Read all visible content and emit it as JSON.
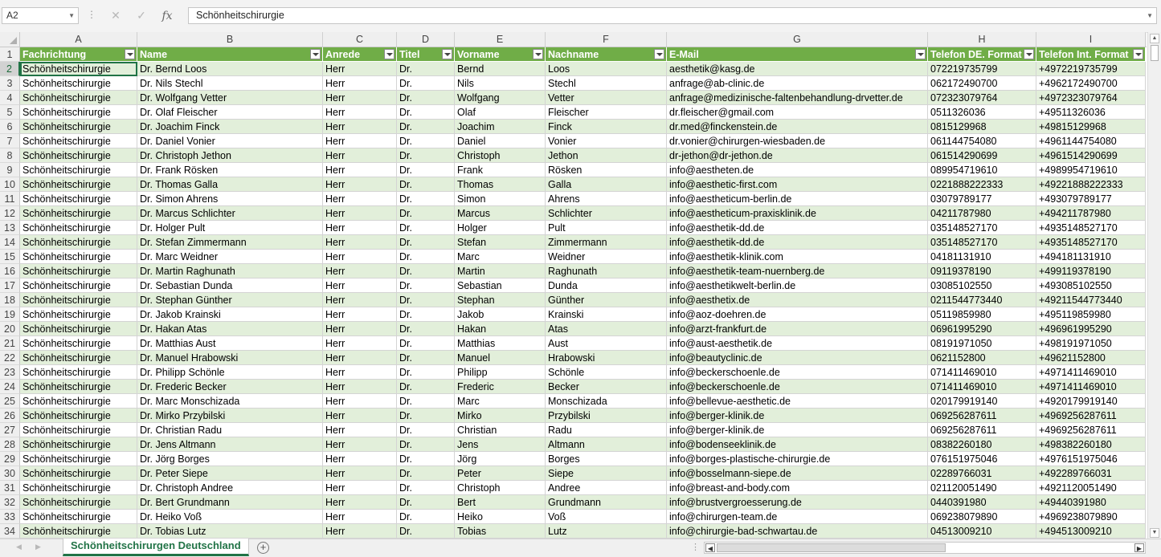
{
  "formula_bar": {
    "name_box": "A2",
    "fx_label": "fx",
    "formula": "Schönheitschirurgie"
  },
  "columns": [
    "A",
    "B",
    "C",
    "D",
    "E",
    "F",
    "G",
    "H",
    "I"
  ],
  "headers": [
    "Fachrichtung",
    "Name",
    "Anrede",
    "Titel",
    "Vorname",
    "Nachname",
    "E-Mail",
    "Telefon DE. Format",
    "Telefon Int. Format"
  ],
  "rows": [
    [
      "Schönheitschirurgie",
      "Dr. Bernd Loos",
      "Herr",
      "Dr.",
      "Bernd",
      "Loos",
      "aesthetik@kasg.de",
      "072219735799",
      "+4972219735799"
    ],
    [
      "Schönheitschirurgie",
      "Dr. Nils Stechl",
      "Herr",
      "Dr.",
      "Nils",
      "Stechl",
      "anfrage@ab-clinic.de",
      "062172490700",
      "+4962172490700"
    ],
    [
      "Schönheitschirurgie",
      "Dr. Wolfgang Vetter",
      "Herr",
      "Dr.",
      "Wolfgang",
      "Vetter",
      "anfrage@medizinische-faltenbehandlung-drvetter.de",
      "072323079764",
      "+4972323079764"
    ],
    [
      "Schönheitschirurgie",
      "Dr. Olaf Fleischer",
      "Herr",
      "Dr.",
      "Olaf",
      "Fleischer",
      "dr.fleischer@gmail.com",
      "0511326036",
      "+49511326036"
    ],
    [
      "Schönheitschirurgie",
      "Dr. Joachim Finck",
      "Herr",
      "Dr.",
      "Joachim",
      "Finck",
      "dr.med@finckenstein.de",
      "0815129968",
      "+49815129968"
    ],
    [
      "Schönheitschirurgie",
      "Dr. Daniel Vonier",
      "Herr",
      "Dr.",
      "Daniel",
      "Vonier",
      "dr.vonier@chirurgen-wiesbaden.de",
      "061144754080",
      "+4961144754080"
    ],
    [
      "Schönheitschirurgie",
      "Dr. Christoph Jethon",
      "Herr",
      "Dr.",
      "Christoph",
      "Jethon",
      "dr-jethon@dr-jethon.de",
      "061514290699",
      "+4961514290699"
    ],
    [
      "Schönheitschirurgie",
      "Dr. Frank Rösken",
      "Herr",
      "Dr.",
      "Frank",
      "Rösken",
      "info@aestheten.de",
      "089954719610",
      "+4989954719610"
    ],
    [
      "Schönheitschirurgie",
      "Dr. Thomas Galla",
      "Herr",
      "Dr.",
      "Thomas",
      "Galla",
      "info@aesthetic-first.com",
      "0221888222333",
      "+49221888222333"
    ],
    [
      "Schönheitschirurgie",
      "Dr. Simon Ahrens",
      "Herr",
      "Dr.",
      "Simon",
      "Ahrens",
      "info@aestheticum-berlin.de",
      "03079789177",
      "+493079789177"
    ],
    [
      "Schönheitschirurgie",
      "Dr. Marcus Schlichter",
      "Herr",
      "Dr.",
      "Marcus",
      "Schlichter",
      "info@aestheticum-praxisklinik.de",
      "04211787980",
      "+494211787980"
    ],
    [
      "Schönheitschirurgie",
      "Dr. Holger Pult",
      "Herr",
      "Dr.",
      "Holger",
      "Pult",
      "info@aesthetik-dd.de",
      "035148527170",
      "+4935148527170"
    ],
    [
      "Schönheitschirurgie",
      "Dr. Stefan Zimmermann",
      "Herr",
      "Dr.",
      "Stefan",
      "Zimmermann",
      "info@aesthetik-dd.de",
      "035148527170",
      "+4935148527170"
    ],
    [
      "Schönheitschirurgie",
      "Dr. Marc Weidner",
      "Herr",
      "Dr.",
      "Marc",
      "Weidner",
      "info@aesthetik-klinik.com",
      "04181131910",
      "+494181131910"
    ],
    [
      "Schönheitschirurgie",
      "Dr. Martin Raghunath",
      "Herr",
      "Dr.",
      "Martin",
      "Raghunath",
      "info@aesthetik-team-nuernberg.de",
      "09119378190",
      "+499119378190"
    ],
    [
      "Schönheitschirurgie",
      "Dr. Sebastian Dunda",
      "Herr",
      "Dr.",
      "Sebastian",
      "Dunda",
      "info@aesthetikwelt-berlin.de",
      "03085102550",
      "+493085102550"
    ],
    [
      "Schönheitschirurgie",
      "Dr. Stephan Günther",
      "Herr",
      "Dr.",
      "Stephan",
      "Günther",
      "info@aesthetix.de",
      "0211544773440",
      "+49211544773440"
    ],
    [
      "Schönheitschirurgie",
      "Dr. Jakob Krainski",
      "Herr",
      "Dr.",
      "Jakob",
      "Krainski",
      "info@aoz-doehren.de",
      "05119859980",
      "+495119859980"
    ],
    [
      "Schönheitschirurgie",
      "Dr. Hakan Atas",
      "Herr",
      "Dr.",
      "Hakan",
      "Atas",
      "info@arzt-frankfurt.de",
      "06961995290",
      "+496961995290"
    ],
    [
      "Schönheitschirurgie",
      "Dr. Matthias Aust",
      "Herr",
      "Dr.",
      "Matthias",
      "Aust",
      "info@aust-aesthetik.de",
      "08191971050",
      "+498191971050"
    ],
    [
      "Schönheitschirurgie",
      "Dr. Manuel Hrabowski",
      "Herr",
      "Dr.",
      "Manuel",
      "Hrabowski",
      "info@beautyclinic.de",
      "0621152800",
      "+49621152800"
    ],
    [
      "Schönheitschirurgie",
      "Dr. Philipp Schönle",
      "Herr",
      "Dr.",
      "Philipp",
      "Schönle",
      "info@beckerschoenle.de",
      "071411469010",
      "+4971411469010"
    ],
    [
      "Schönheitschirurgie",
      "Dr. Frederic Becker",
      "Herr",
      "Dr.",
      "Frederic",
      "Becker",
      "info@beckerschoenle.de",
      "071411469010",
      "+4971411469010"
    ],
    [
      "Schönheitschirurgie",
      "Dr. Marc Monschizada",
      "Herr",
      "Dr.",
      "Marc",
      "Monschizada",
      "info@bellevue-aesthetic.de",
      "020179919140",
      "+4920179919140"
    ],
    [
      "Schönheitschirurgie",
      "Dr. Mirko Przybilski",
      "Herr",
      "Dr.",
      "Mirko",
      "Przybilski",
      "info@berger-klinik.de",
      "069256287611",
      "+4969256287611"
    ],
    [
      "Schönheitschirurgie",
      "Dr. Christian Radu",
      "Herr",
      "Dr.",
      "Christian",
      "Radu",
      "info@berger-klinik.de",
      "069256287611",
      "+4969256287611"
    ],
    [
      "Schönheitschirurgie",
      "Dr. Jens Altmann",
      "Herr",
      "Dr.",
      "Jens",
      "Altmann",
      "info@bodenseeklinik.de",
      "08382260180",
      "+498382260180"
    ],
    [
      "Schönheitschirurgie",
      "Dr. Jörg Borges",
      "Herr",
      "Dr.",
      "Jörg",
      "Borges",
      "info@borges-plastische-chirurgie.de",
      "076151975046",
      "+4976151975046"
    ],
    [
      "Schönheitschirurgie",
      "Dr. Peter Siepe",
      "Herr",
      "Dr.",
      "Peter",
      "Siepe",
      "info@bosselmann-siepe.de",
      "02289766031",
      "+492289766031"
    ],
    [
      "Schönheitschirurgie",
      "Dr. Christoph Andree",
      "Herr",
      "Dr.",
      "Christoph",
      "Andree",
      "info@breast-and-body.com",
      "021120051490",
      "+4921120051490"
    ],
    [
      "Schönheitschirurgie",
      "Dr. Bert Grundmann",
      "Herr",
      "Dr.",
      "Bert",
      "Grundmann",
      "info@brustvergroesserung.de",
      "0440391980",
      "+49440391980"
    ],
    [
      "Schönheitschirurgie",
      "Dr. Heiko Voß",
      "Herr",
      "Dr.",
      "Heiko",
      "Voß",
      "info@chirurgen-team.de",
      "069238079890",
      "+4969238079890"
    ],
    [
      "Schönheitschirurgie",
      "Dr. Tobias Lutz",
      "Herr",
      "Dr.",
      "Tobias",
      "Lutz",
      "info@chirurgie-bad-schwartau.de",
      "04513009210",
      "+494513009210"
    ]
  ],
  "sheet_tab": "Schönheitschirurgen Deutschland",
  "add_sheet_label": "+",
  "colors": {
    "header_green": "#70ad47",
    "band_green": "#e2efda",
    "excel_green": "#217346"
  }
}
